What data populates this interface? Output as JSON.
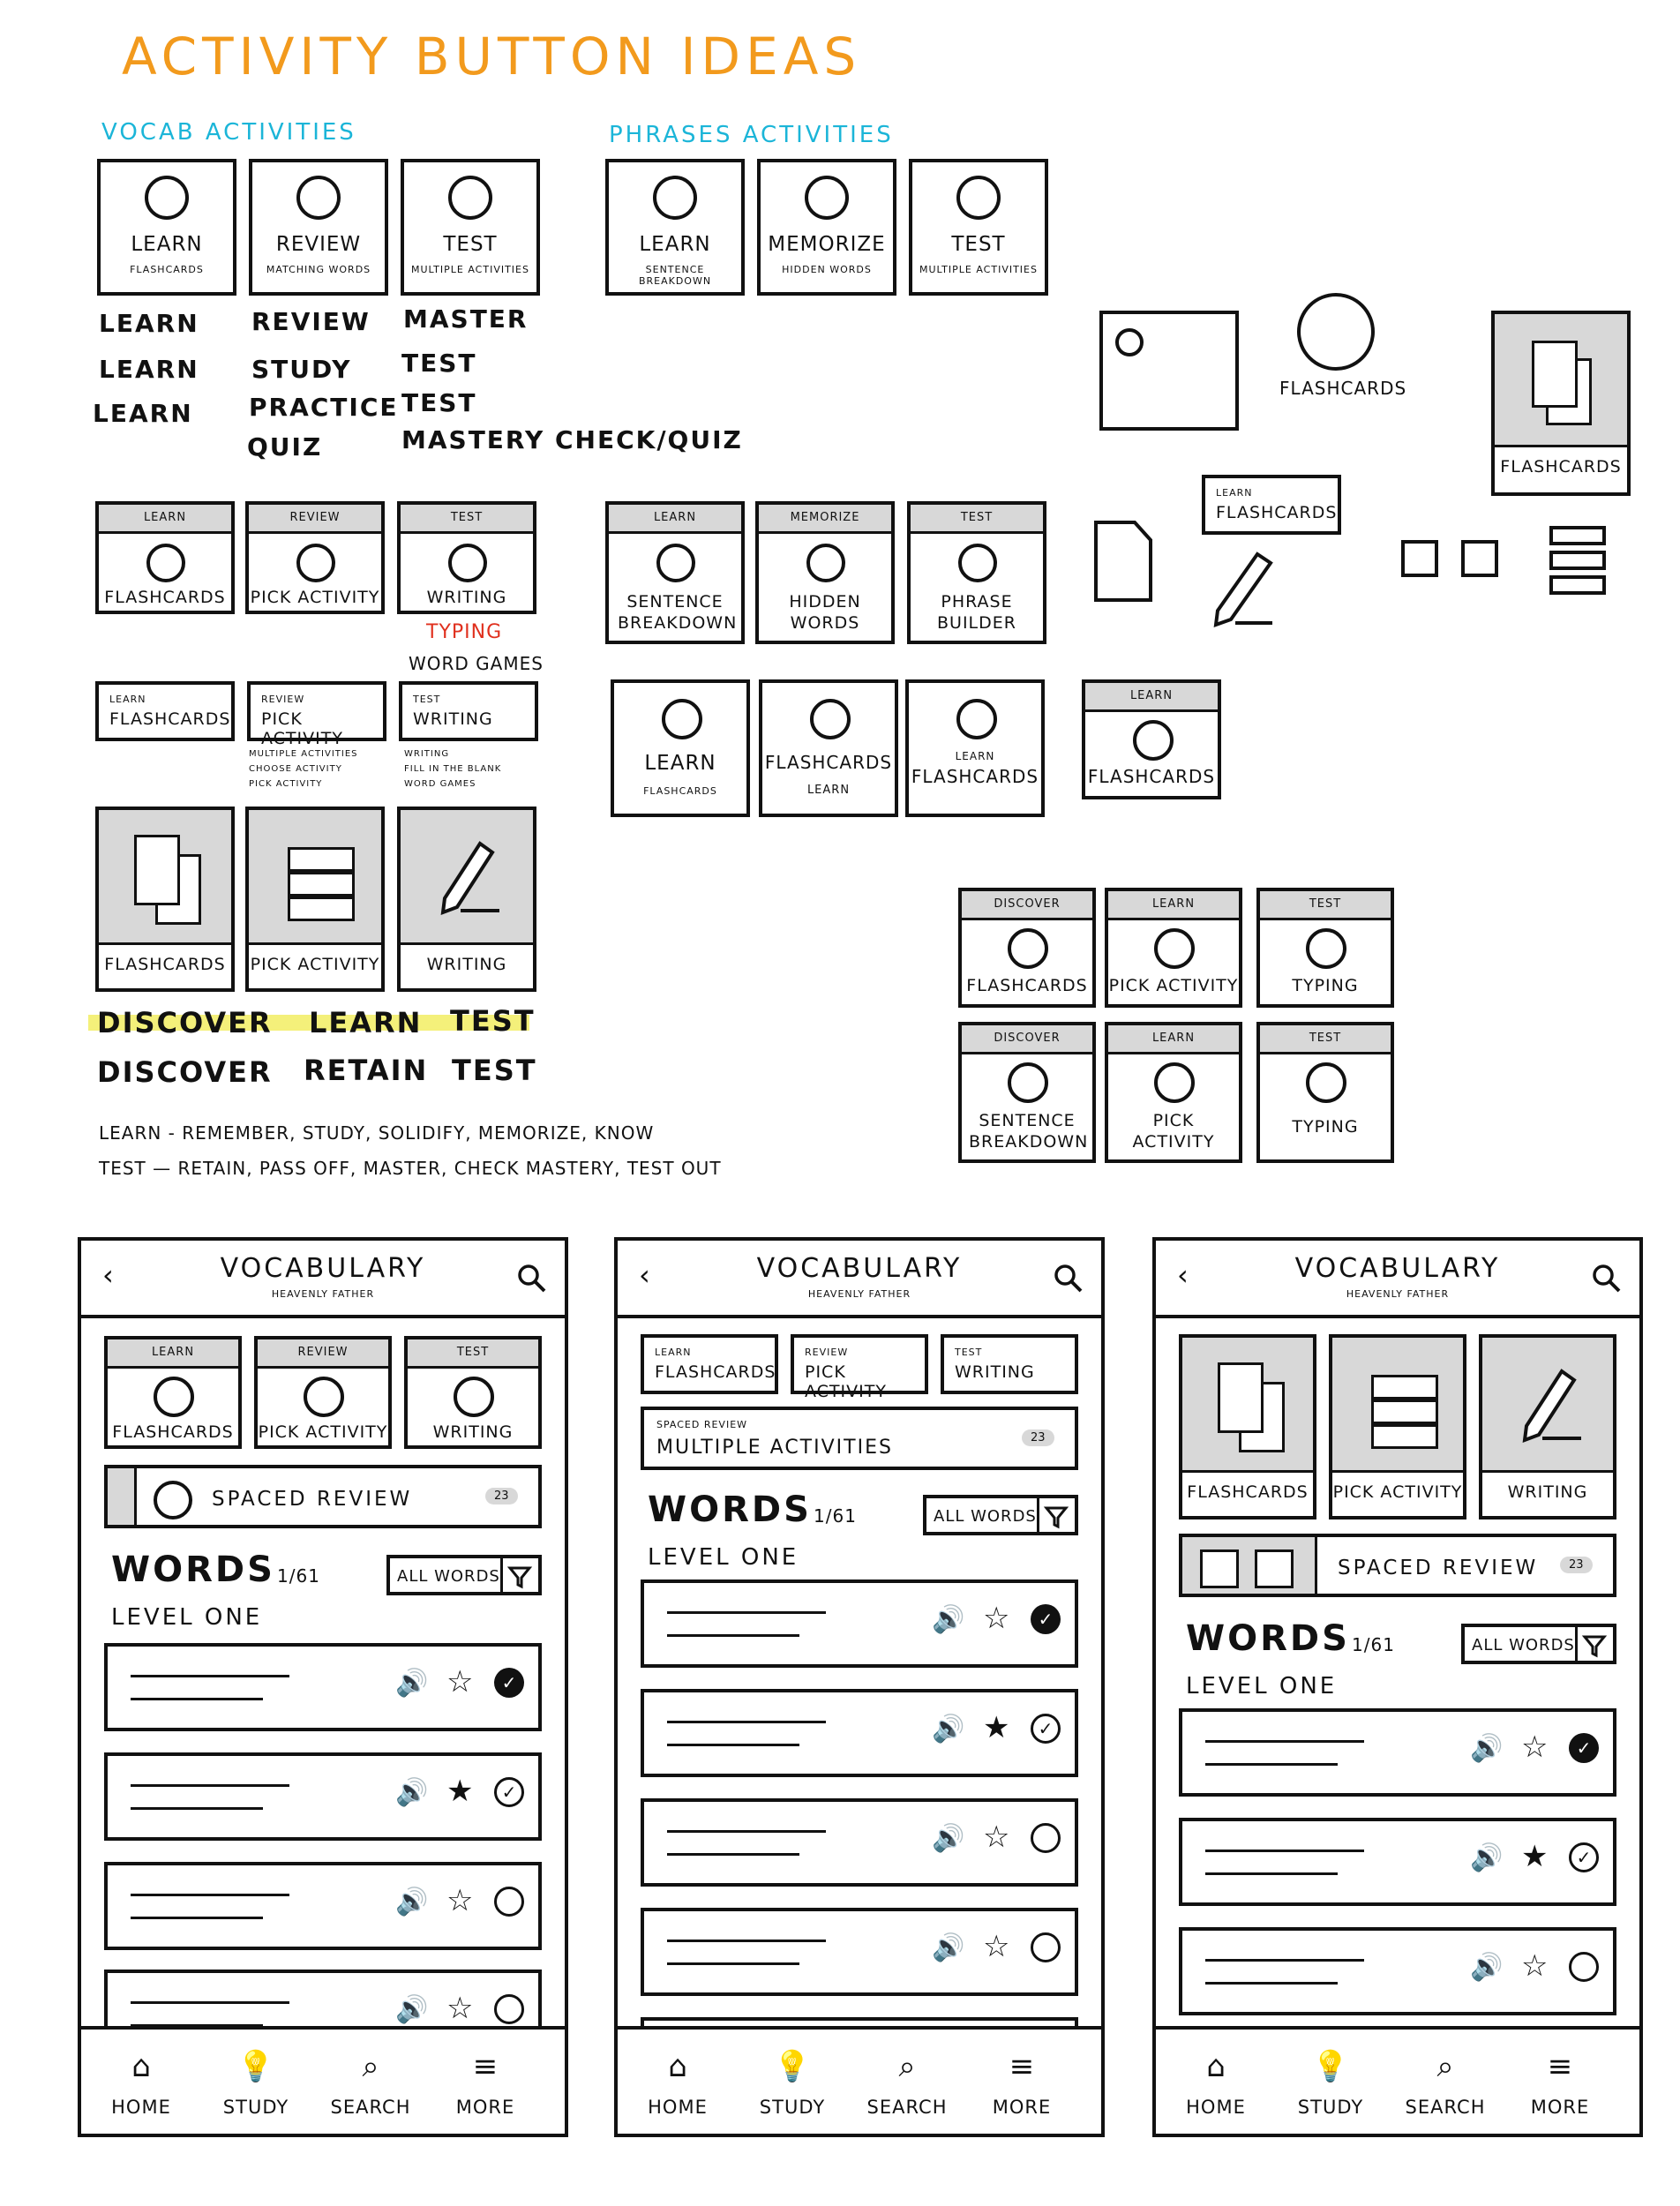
{
  "title": "Activity Button Ideas",
  "sections": {
    "vocab": "Vocab Activities",
    "phrases": "Phrases Activities"
  },
  "vocab_row1": [
    {
      "label": "Learn",
      "sub": "Flashcards"
    },
    {
      "label": "Review",
      "sub": "Matching Words"
    },
    {
      "label": "Test",
      "sub": "Multiple Activities"
    }
  ],
  "phrases_row1": [
    {
      "label": "Learn",
      "sub": "Sentence Breakdown"
    },
    {
      "label": "Memorize",
      "sub": "Hidden Words"
    },
    {
      "label": "Test",
      "sub": "Multiple Activities"
    }
  ],
  "word_lists": {
    "col1": [
      "Learn",
      "Learn",
      "Learn"
    ],
    "col2": [
      "Review",
      "Study",
      "Practice",
      "Quiz"
    ],
    "col3": [
      "Master",
      "Test",
      "Test",
      "Mastery check/quiz"
    ]
  },
  "vocab_row2": [
    {
      "header": "Learn",
      "label": "Flashcards"
    },
    {
      "header": "Review",
      "label": "Pick Activity"
    },
    {
      "header": "Test",
      "label": "Writing"
    }
  ],
  "typing_note": "Typing",
  "word_games_note": "Word Games",
  "phrases_row2": [
    {
      "header": "Learn",
      "label": "Sentence Breakdown"
    },
    {
      "header": "Memorize",
      "label": "Hidden Words"
    },
    {
      "header": "Test",
      "label": "Phrase Builder"
    }
  ],
  "vocab_row3": [
    {
      "small": "Learn",
      "label": "Flashcards"
    },
    {
      "small": "Review",
      "label": "Pick Activity"
    },
    {
      "small": "Test",
      "label": "Writing"
    }
  ],
  "vocab_row3_notes": {
    "review": [
      "Multiple Activities",
      "Choose Activity",
      "Pick Activity"
    ],
    "test": [
      "Writing",
      "Fill in the Blank",
      "Word Games"
    ]
  },
  "phrases_row3": [
    {
      "label": "Learn",
      "sub": "Flashcards"
    },
    {
      "label": "Flashcards",
      "sub": "Learn"
    },
    {
      "small": "Learn",
      "label": "Flashcards"
    },
    {
      "header": "Learn",
      "label": "Flashcards"
    }
  ],
  "side_ideas": {
    "circle_label": "Flashcards",
    "gray_card_label": "Flashcards",
    "small_card_top": "Learn",
    "small_card_label": "Flashcards"
  },
  "icon_row": [
    {
      "label": "Flashcards"
    },
    {
      "label": "Pick Activity"
    },
    {
      "label": "Writing"
    }
  ],
  "flow1": [
    "Discover",
    "Learn",
    "Test"
  ],
  "flow2": [
    "Discover",
    "Retain",
    "Test"
  ],
  "notes": [
    "Learn - Remember, Study, Solidify, Memorize, Know",
    "Test — Retain, Pass off, Master, Check Mastery, Test out"
  ],
  "grid_right": [
    {
      "header": "Discover",
      "label": "Flashcards"
    },
    {
      "header": "Learn",
      "label": "Pick Activity"
    },
    {
      "header": "Test",
      "label": "Typing"
    },
    {
      "header": "Discover",
      "label": "Sentence Breakdown"
    },
    {
      "header": "Learn",
      "label": "Pick Activity"
    },
    {
      "header": "Test",
      "label": "Typing"
    }
  ],
  "phone": {
    "title": "Vocabulary",
    "subtitle": "Heavenly Father",
    "cards": [
      {
        "header": "Learn",
        "label": "Flashcards"
      },
      {
        "header": "Review",
        "label": "Pick Activity"
      },
      {
        "header": "Test",
        "label": "Writing"
      }
    ],
    "spaced_review": "Spaced Review",
    "spaced_small": "Spaced Review",
    "multiple_activities": "Multiple Activities",
    "count": "23",
    "words": "Words",
    "words_count": "1/61",
    "filter": "All Words",
    "level": "Level One",
    "nav": [
      "Home",
      "Study",
      "Search",
      "More"
    ]
  }
}
